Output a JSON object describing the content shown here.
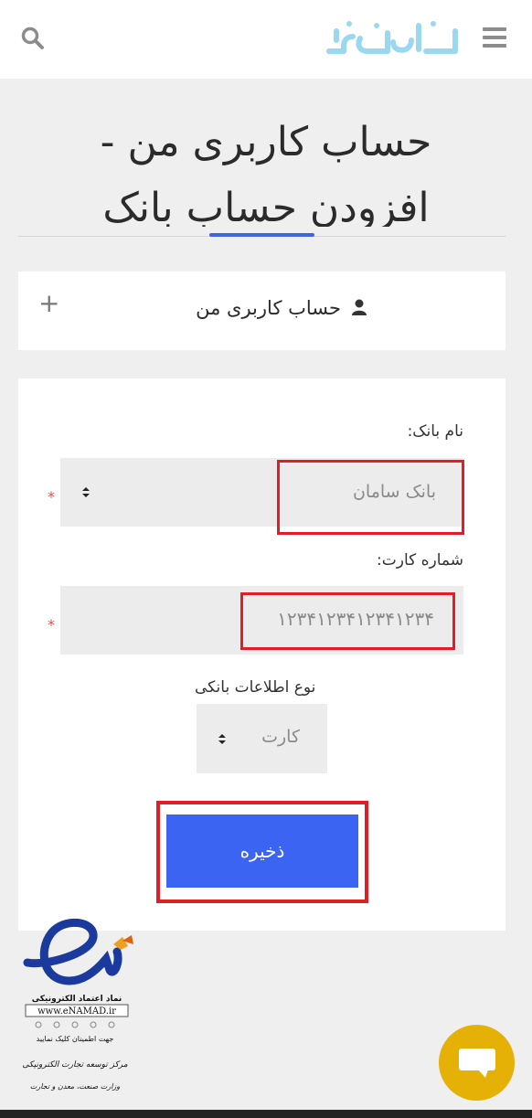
{
  "header": {
    "logo_text": "ایران کیفت",
    "search_icon": "search-icon",
    "menu_icon": "hamburger-menu-icon"
  },
  "page": {
    "title_line1": "حساب کاربری من -",
    "title_line2": "افزودن حساب بانک"
  },
  "account_section": {
    "label": "حساب کاربری من",
    "user_icon": "user-icon",
    "expand_icon": "plus-icon",
    "expand_symbol": "+"
  },
  "form": {
    "bank_name_label": "نام بانک:",
    "bank_name_value": "بانک سامان",
    "card_number_label": "شماره کارت:",
    "card_number_value": "۱۲۳۴۱۲۳۴۱۲۳۴۱۲۳۴",
    "info_type_label": "نوع اطلاعات بانکی",
    "info_type_value": "کارت",
    "required_mark": "*",
    "save_label": "ذخیره"
  },
  "footer": {
    "enamad_line1": "نماد اعتماد الکترونیکی",
    "enamad_url": "www.eNAMAD.ir",
    "enamad_line2": "جهت اطمینان کلیک نمایید",
    "enamad_line3": "مرکز توسعه تجارت الکترونیکی",
    "enamad_line4": "وزارت صنعت، معدن و تجارت",
    "chat_icon": "chat-bubble-icon"
  },
  "colors": {
    "accent_blue": "#3b64f2",
    "highlight_red": "#e11d25",
    "chat_yellow": "#e5b107",
    "required_red": "#d9534f"
  }
}
